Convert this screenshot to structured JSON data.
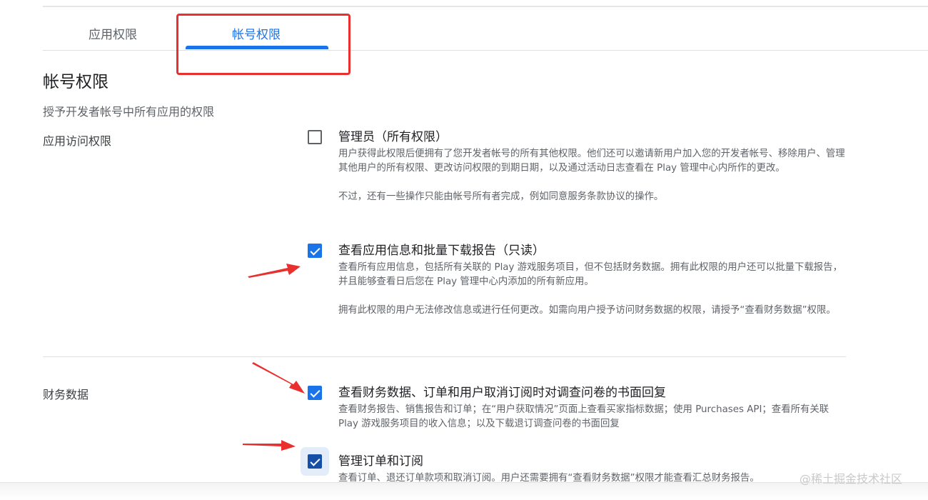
{
  "tabs": {
    "app_permissions": "应用权限",
    "account_permissions": "帐号权限"
  },
  "page": {
    "title": "帐号权限",
    "subtitle": "授予开发者帐号中所有应用的权限"
  },
  "sections": {
    "app_access": "应用访问权限",
    "financial": "财务数据"
  },
  "permissions": [
    {
      "checked": false,
      "title": "管理员（所有权限）",
      "desc1": "用户获得此权限后便拥有了您开发者帐号的所有其他权限。他们还可以邀请新用户加入您的开发者帐号、移除用户、管理其他用户的所有权限、更改访问权限的到期日期，以及通过活动日志查看在 Play 管理中心内所作的更改。",
      "desc2": "不过，还有一些操作只能由帐号所有者完成，例如同意服务条款协议的操作。"
    },
    {
      "checked": true,
      "title": "查看应用信息和批量下载报告（只读）",
      "desc1": "查看所有应用信息，包括所有关联的 Play 游戏服务项目，但不包括财务数据。拥有此权限的用户还可以批量下载报告，并且能够查看日后您在 Play 管理中心内添加的所有新应用。",
      "desc2": "拥有此权限的用户无法修改信息或进行任何更改。如需向用户授予访问财务数据的权限，请授予“查看财务数据”权限。"
    },
    {
      "checked": true,
      "title": "查看财务数据、订单和用户取消订阅时对调查问卷的书面回复",
      "desc1": "查看财务报告、销售报告和订单；在“用户获取情况”页面上查看买家指标数据；使用 Purchases API；查看所有关联 Play 游戏服务项目的收入信息；以及下载退订调查问卷的书面回复"
    },
    {
      "checked": true,
      "title": "管理订单和订阅",
      "desc1": "查看订单、退还订单款项和取消订阅。用户还需要拥有“查看财务数据”权限才能查看汇总财务报告。"
    }
  ],
  "watermark": "@稀土掘金技术社区",
  "colors": {
    "accent": "#1a73e8",
    "annotation_red": "#e8312f"
  }
}
